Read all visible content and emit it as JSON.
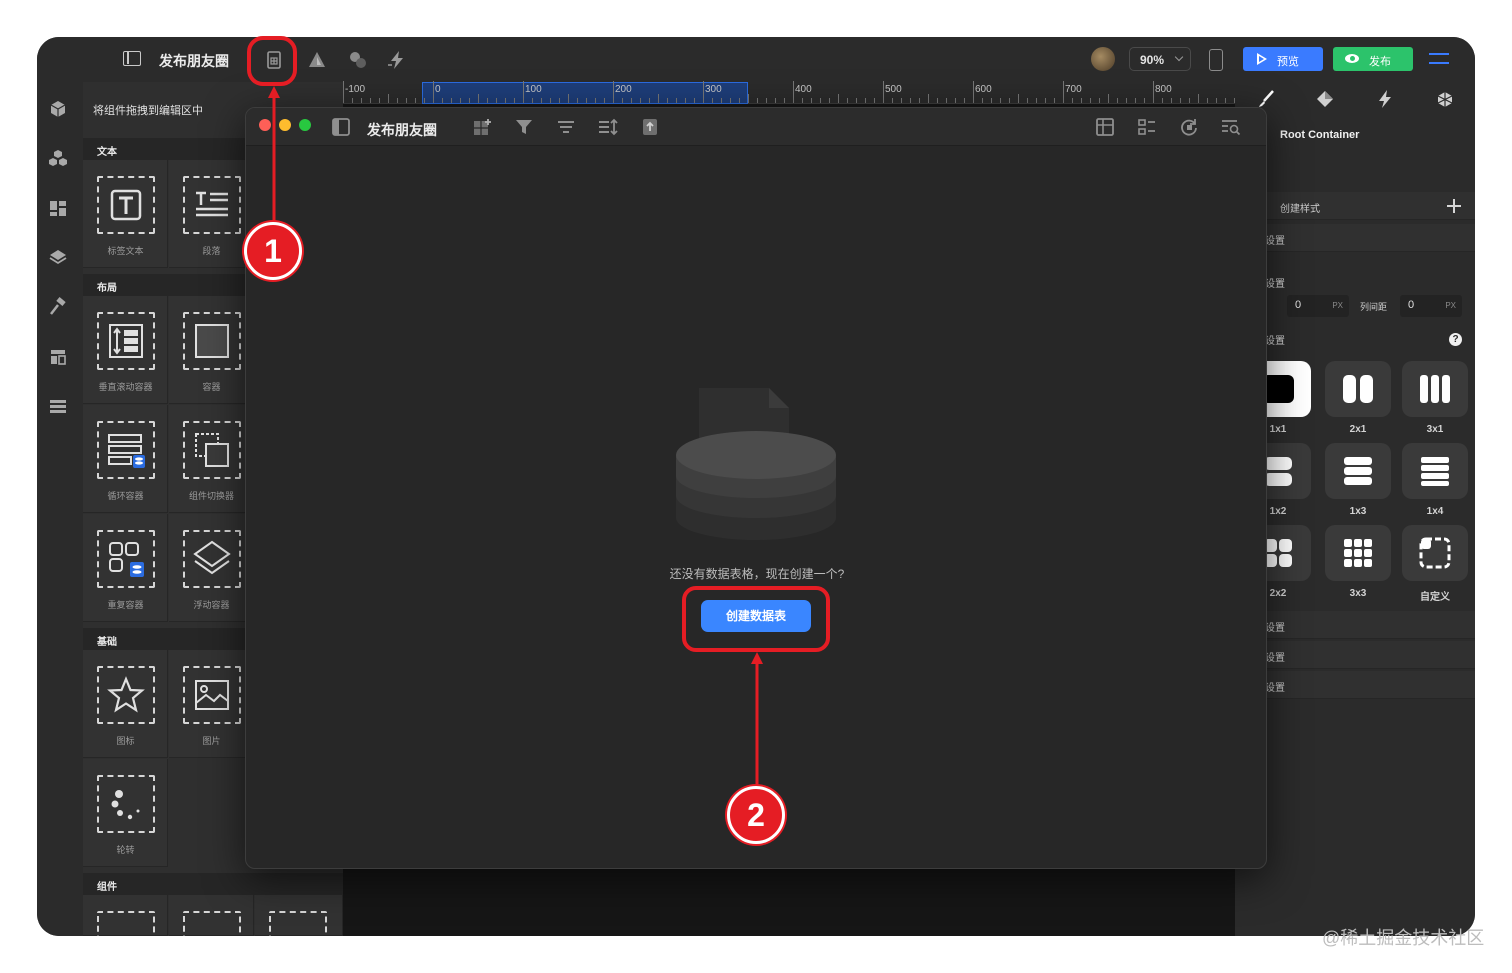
{
  "app": {
    "title": "发布朋友圈",
    "zoom": "90%",
    "preview_label": "预览",
    "publish_label": "发布"
  },
  "component_panel": {
    "drag_hint": "将组件拖拽到编辑区中",
    "sections": {
      "text": "文本",
      "layout": "布局",
      "basic": "基础",
      "components": "组件"
    },
    "tiles": {
      "label_text": "标签文本",
      "paragraph": "段落",
      "vertical_scroll": "垂直滚动容器",
      "container": "容器",
      "loop_container": "循环容器",
      "component_switcher": "组件切换器",
      "repeat_container": "重复容器",
      "floating_container": "浮动容器",
      "icon": "图标",
      "image": "图片",
      "carousel": "轮转"
    }
  },
  "ruler": {
    "labels": [
      "-100",
      "0",
      "100",
      "200",
      "300",
      "400",
      "500",
      "600",
      "700",
      "800"
    ]
  },
  "properties": {
    "root_title": "Root Container",
    "create_style": "创建样式",
    "row1": "设置",
    "spacing_header": "设置",
    "row_gap_value": "0",
    "col_gap_label": "列间距",
    "col_gap_value": "0",
    "unit": "PX",
    "grid_header": "设置",
    "help": "?",
    "layouts": [
      "1x1",
      "2x1",
      "3x1",
      "1x2",
      "1x3",
      "1x4",
      "2x2",
      "3x3",
      "自定义"
    ],
    "row_a": "设置",
    "row_b": "设置",
    "row_c": "设置"
  },
  "dialog": {
    "title": "发布朋友圈",
    "empty_message": "还没有数据表格，现在创建一个?",
    "create_button": "创建数据表"
  },
  "annotations": {
    "badge1": "1",
    "badge2": "2",
    "color": "#e51d24"
  },
  "watermark": "@稀土掘金技术社区",
  "colors": {
    "accent_blue": "#3a7bff",
    "publish_green": "#2cc36b",
    "annotation_red": "#e51d24"
  }
}
